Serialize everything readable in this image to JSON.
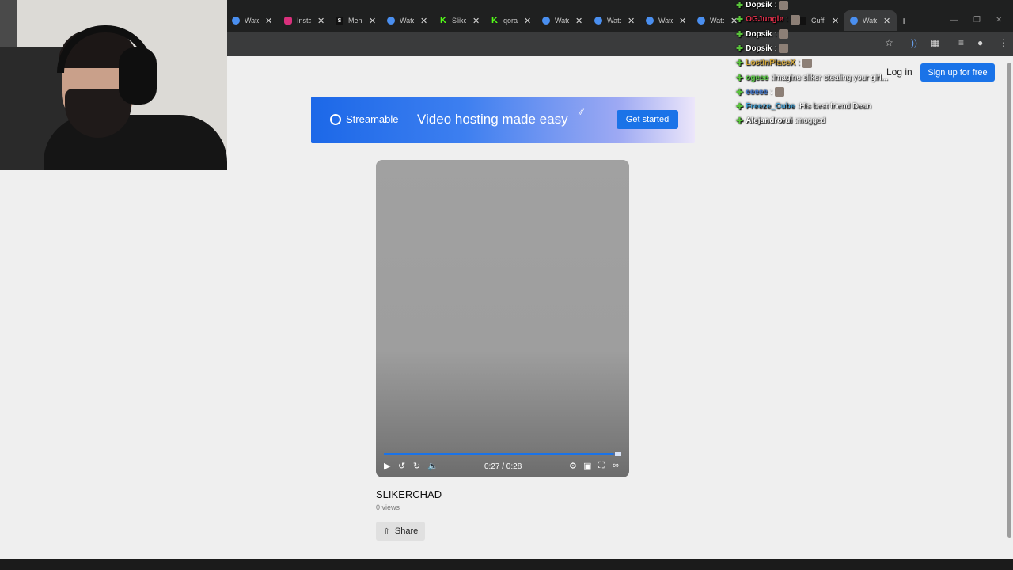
{
  "browser": {
    "tabs": [
      {
        "title": "Watc",
        "favicon": "streamable-icon"
      },
      {
        "title": "Insta",
        "favicon": "instagram-icon"
      },
      {
        "title": "Men",
        "favicon": "s-icon"
      },
      {
        "title": "Watc",
        "favicon": "streamable-icon"
      },
      {
        "title": "Slike",
        "favicon": "kick-icon"
      },
      {
        "title": "qora",
        "favicon": "kick-icon"
      },
      {
        "title": "Watc",
        "favicon": "streamable-icon"
      },
      {
        "title": "Watc",
        "favicon": "streamable-icon"
      },
      {
        "title": "Watc",
        "favicon": "streamable-icon"
      },
      {
        "title": "Watc",
        "favicon": "streamable-icon"
      },
      {
        "title": "Cuffi",
        "favicon": "video-icon"
      },
      {
        "title": "Watc",
        "favicon": "streamable-icon",
        "active": true
      }
    ],
    "new_tab": "+"
  },
  "header": {
    "login_label": "Log in",
    "signup_label": "Sign up for free"
  },
  "banner": {
    "brand": "Streamable",
    "tagline": "Video hosting made easy",
    "cta_label": "Get started"
  },
  "player": {
    "time_display": "0:27 / 0:28",
    "progress_fraction": 0.964
  },
  "video": {
    "title": "SLIKERCHAD",
    "views": "0 views",
    "share_label": "Share"
  },
  "chat": [
    {
      "user": "Dopsik",
      "message": "",
      "user_color": "#ffffff"
    },
    {
      "user": "OGJungle",
      "message": "",
      "user_color": "#e0304b"
    },
    {
      "user": "Dopsik",
      "message": "",
      "user_color": "#ffffff"
    },
    {
      "user": "Dopsik",
      "message": "",
      "user_color": "#ffffff"
    },
    {
      "user": "LostInPlaceX",
      "message": "",
      "user_color": "#d4a93c"
    },
    {
      "user": "ogeee",
      "message": "imagine sliker stealing your girl...",
      "user_color": "#5fd04a"
    },
    {
      "user": "eeeee",
      "message": "",
      "user_color": "#4a7fd6"
    },
    {
      "user": "Freeze_Cube",
      "message": "His best friend Dean",
      "user_color": "#4aa6d9"
    },
    {
      "user": "Alejandrorui",
      "message": "mogged",
      "user_color": "#ffffff"
    }
  ]
}
